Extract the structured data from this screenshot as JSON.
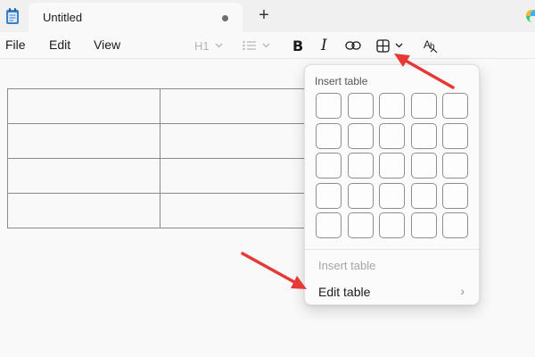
{
  "tab": {
    "title": "Untitled"
  },
  "menu": {
    "file": "File",
    "edit": "Edit",
    "view": "View"
  },
  "toolbar": {
    "heading": "H1"
  },
  "popup": {
    "title": "Insert table",
    "grid": {
      "rows": 5,
      "cols": 5
    },
    "insert_label": "Insert table",
    "edit_label": "Edit table"
  },
  "document": {
    "table": {
      "rows": 4,
      "cols": 2
    }
  },
  "colors": {
    "annotation_arrow": "#e53935",
    "cell_border": "#8e8e8e"
  }
}
